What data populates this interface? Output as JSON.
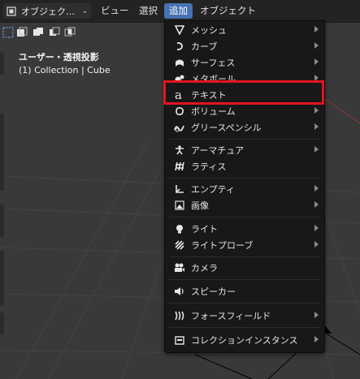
{
  "header": {
    "mode_label": "オブジェク…",
    "menus": [
      "ビュー",
      "選択",
      "追加",
      "オブジェクト"
    ],
    "active_menu": "追加"
  },
  "viewport": {
    "view_name": "ユーザー・透視投影",
    "selection_info": "(1) Collection | Cube"
  },
  "add_menu": {
    "items": [
      {
        "label": "メッシュ",
        "icon": "mesh-icon",
        "submenu": true
      },
      {
        "label": "カーブ",
        "icon": "curve-icon",
        "submenu": true
      },
      {
        "label": "サーフェス",
        "icon": "surface-icon",
        "submenu": true
      },
      {
        "label": "メタボール",
        "icon": "metaball-icon",
        "submenu": true
      },
      {
        "label": "テキスト",
        "icon": "text-icon",
        "submenu": false
      },
      {
        "label": "ボリューム",
        "icon": "volume-icon",
        "submenu": true
      },
      {
        "label": "グリースペンシル",
        "icon": "grease-pencil-icon",
        "submenu": true
      },
      {
        "label": "アーマチュア",
        "icon": "armature-icon",
        "submenu": true
      },
      {
        "label": "ラティス",
        "icon": "lattice-icon",
        "submenu": false
      },
      {
        "label": "エンプティ",
        "icon": "empty-icon",
        "submenu": true
      },
      {
        "label": "画像",
        "icon": "image-icon",
        "submenu": true
      },
      {
        "label": "ライト",
        "icon": "light-icon",
        "submenu": true
      },
      {
        "label": "ライトプローブ",
        "icon": "light-probe-icon",
        "submenu": true
      },
      {
        "label": "カメラ",
        "icon": "camera-icon",
        "submenu": false
      },
      {
        "label": "スピーカー",
        "icon": "speaker-icon",
        "submenu": false
      },
      {
        "label": "フォースフィールド",
        "icon": "force-field-icon",
        "submenu": true
      },
      {
        "label": "コレクションインスタンス",
        "icon": "collection-instance-icon",
        "submenu": true
      }
    ],
    "highlighted_item": "テキスト"
  },
  "colors": {
    "active_menu_bg": "#4772b3",
    "highlight_border": "#e3131f",
    "menu_bg": "#181818"
  }
}
